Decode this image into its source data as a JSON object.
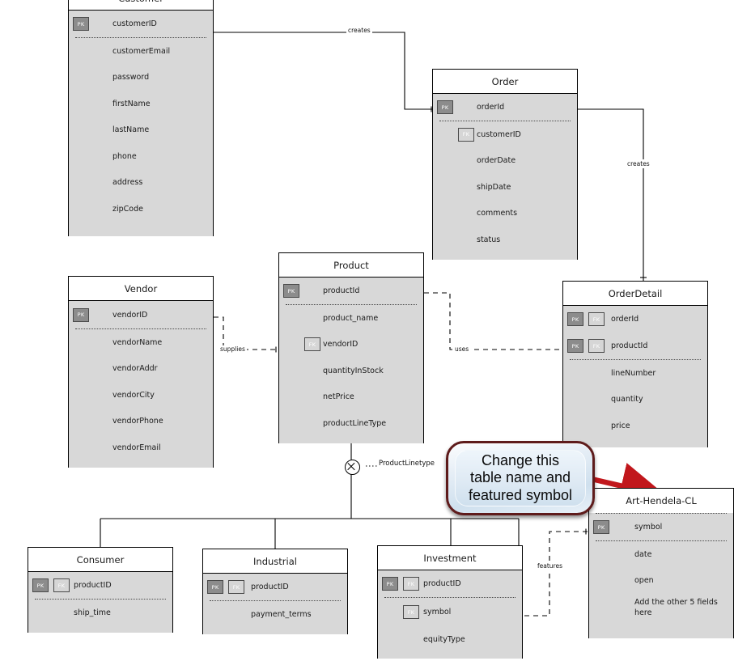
{
  "diagram": {
    "type": "entity-relationship-diagram",
    "badges": {
      "pk": "PK",
      "fk": "FK"
    },
    "colors": {
      "entity_body": "#d8d8d8",
      "entity_header": "#ffffff",
      "pk_badge": "#8c8c8c",
      "fk_badge": "#d6d6d6",
      "callout_border": "#5e1b1b",
      "callout_fill": "#cfe0ee",
      "arrow": "#c1171c",
      "line": "#000000"
    }
  },
  "entities": {
    "customer": {
      "title": "Customer",
      "attrs": [
        {
          "name": "customerID",
          "keys": [
            "PK"
          ]
        },
        {
          "name": "customerEmail",
          "keys": []
        },
        {
          "name": "password",
          "keys": []
        },
        {
          "name": "firstName",
          "keys": []
        },
        {
          "name": "lastName",
          "keys": []
        },
        {
          "name": "phone",
          "keys": []
        },
        {
          "name": "address",
          "keys": []
        },
        {
          "name": "zipCode",
          "keys": []
        }
      ]
    },
    "order": {
      "title": "Order",
      "attrs": [
        {
          "name": "orderId",
          "keys": [
            "PK"
          ]
        },
        {
          "name": "customerID",
          "keys": [
            "FK"
          ]
        },
        {
          "name": "orderDate",
          "keys": []
        },
        {
          "name": "shipDate",
          "keys": []
        },
        {
          "name": "comments",
          "keys": []
        },
        {
          "name": "status",
          "keys": []
        }
      ]
    },
    "product": {
      "title": "Product",
      "attrs": [
        {
          "name": "productId",
          "keys": [
            "PK"
          ]
        },
        {
          "name": "product_name",
          "keys": []
        },
        {
          "name": "vendorID",
          "keys": [
            "FK"
          ]
        },
        {
          "name": "quantityInStock",
          "keys": []
        },
        {
          "name": "netPrice",
          "keys": []
        },
        {
          "name": "productLineType",
          "keys": []
        }
      ]
    },
    "vendor": {
      "title": "Vendor",
      "attrs": [
        {
          "name": "vendorID",
          "keys": [
            "PK"
          ]
        },
        {
          "name": "vendorName",
          "keys": []
        },
        {
          "name": "vendorAddr",
          "keys": []
        },
        {
          "name": "vendorCity",
          "keys": []
        },
        {
          "name": "vendorPhone",
          "keys": []
        },
        {
          "name": "vendorEmail",
          "keys": []
        }
      ]
    },
    "orderdetail": {
      "title": "OrderDetail",
      "attrs": [
        {
          "name": "orderId",
          "keys": [
            "PK",
            "FK"
          ]
        },
        {
          "name": "productId",
          "keys": [
            "PK",
            "FK"
          ]
        },
        {
          "name": "lineNumber",
          "keys": []
        },
        {
          "name": "quantity",
          "keys": []
        },
        {
          "name": "price",
          "keys": []
        }
      ]
    },
    "consumer": {
      "title": "Consumer",
      "attrs": [
        {
          "name": "productID",
          "keys": [
            "PK",
            "FK"
          ]
        },
        {
          "name": "ship_time",
          "keys": []
        }
      ]
    },
    "industrial": {
      "title": "Industrial",
      "attrs": [
        {
          "name": "productID",
          "keys": [
            "PK",
            "FK"
          ]
        },
        {
          "name": "payment_terms",
          "keys": []
        }
      ]
    },
    "investment": {
      "title": "Investment",
      "attrs": [
        {
          "name": "productID",
          "keys": [
            "PK",
            "FK"
          ]
        },
        {
          "name": "symbol",
          "keys": [
            "FK"
          ]
        },
        {
          "name": "equityType",
          "keys": []
        }
      ]
    },
    "arthendela": {
      "title": "Art-Hendela-CL",
      "attrs": [
        {
          "name": "symbol",
          "keys": [
            "PK"
          ]
        },
        {
          "name": "date",
          "keys": []
        },
        {
          "name": "open",
          "keys": []
        },
        {
          "name": "Add the other 5 fields here",
          "keys": []
        }
      ]
    }
  },
  "relationships": {
    "customer_order": "creates",
    "order_orderdetail": "creates",
    "vendor_product": "supplies",
    "product_orderdetail": "uses",
    "investment_arthendela": "features",
    "product_subtypes": "ProductLinetype"
  },
  "annotation": {
    "line1": "Change this",
    "line2": "table name and",
    "line3": "featured symbol"
  }
}
